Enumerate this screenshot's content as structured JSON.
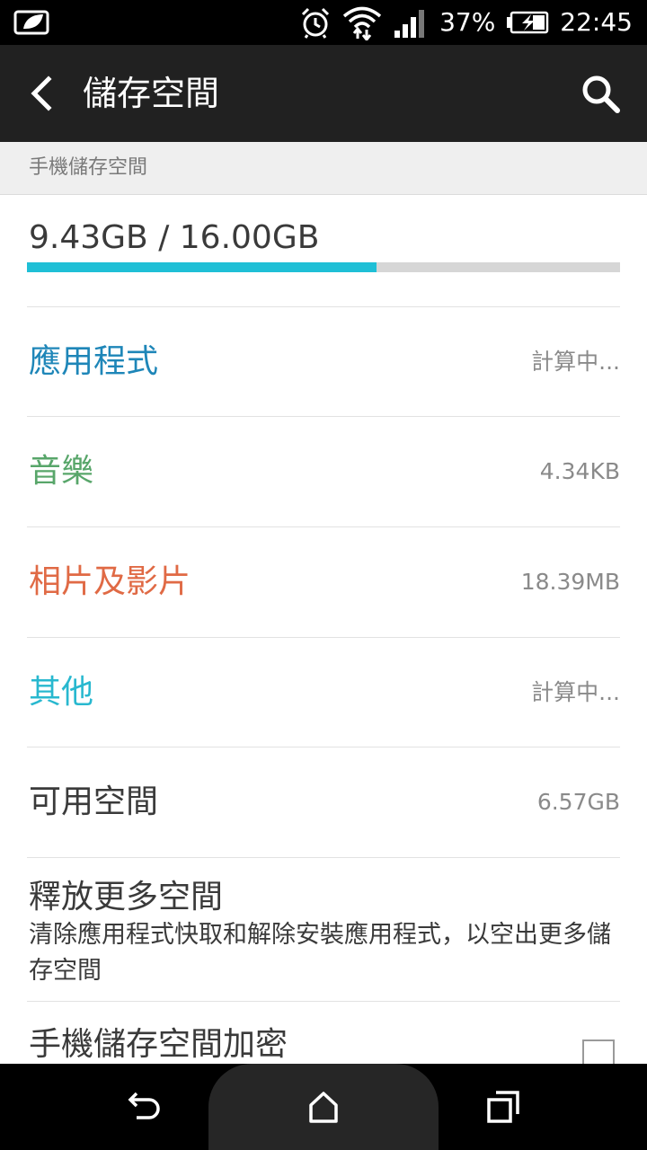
{
  "status_bar": {
    "icons": [
      "eco-leaf-icon",
      "alarm-clock-icon",
      "wifi-icon",
      "signal-icon",
      "battery-charging-icon"
    ],
    "battery_percent": "37%",
    "time": "22:45"
  },
  "app_bar": {
    "title": "儲存空間",
    "icons": [
      "back-arrow-icon",
      "search-icon"
    ]
  },
  "section_header": "手機儲存空間",
  "storage": {
    "total_text": "9.43GB / 16.00GB",
    "used_fraction": 0.589,
    "bar_color": "#1fbfd6"
  },
  "categories": [
    {
      "label": "應用程式",
      "value": "計算中...",
      "color": "#1e86b8"
    },
    {
      "label": "音樂",
      "value": "4.34KB",
      "color": "#58a66a"
    },
    {
      "label": "相片及影片",
      "value": "18.39MB",
      "color": "#e06a45"
    },
    {
      "label": "其他",
      "value": "計算中...",
      "color": "#28b8cf"
    },
    {
      "label": "可用空間",
      "value": "6.57GB",
      "color": "#3a3a3a"
    }
  ],
  "free_up": {
    "title": "釋放更多空間",
    "description": "清除應用程式快取和解除安裝應用程式，以空出更多儲存空間"
  },
  "encrypt": {
    "title": "手機儲存空間加密",
    "checked": false
  },
  "nav_bar": {
    "icons": [
      "back-nav-icon",
      "home-icon",
      "recents-icon"
    ]
  }
}
